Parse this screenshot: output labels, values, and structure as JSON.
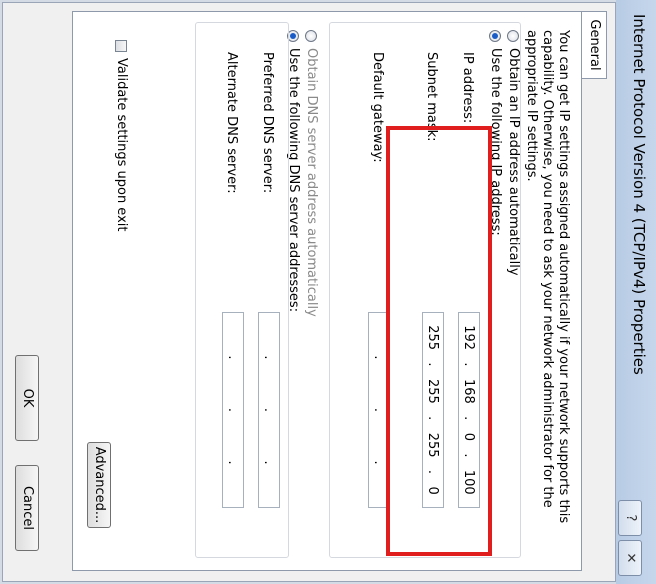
{
  "window": {
    "title": "Internet Protocol Version 4 (TCP/IPv4) Properties",
    "help_glyph": "?",
    "close_glyph": "✕"
  },
  "tabs": [
    {
      "label": "General"
    }
  ],
  "general": {
    "intro": "You can get IP settings assigned automatically if your network supports this capability. Otherwise, you need to ask your network administrator for the appropriate IP settings.",
    "ip_mode": {
      "auto_label": "Obtain an IP address automatically",
      "manual_label": "Use the following IP address:",
      "selected": "manual"
    },
    "ip_fields": {
      "ip_label": "IP address:",
      "ip_value": [
        "192",
        "168",
        "0",
        "100"
      ],
      "subnet_label": "Subnet mask:",
      "subnet_value": [
        "255",
        "255",
        "255",
        "0"
      ],
      "gateway_label": "Default gateway:",
      "gateway_value": [
        "",
        "",
        "",
        ""
      ]
    },
    "dns_mode": {
      "auto_label": "Obtain DNS server address automatically",
      "manual_label": "Use the following DNS server addresses:",
      "selected": "manual"
    },
    "dns_fields": {
      "preferred_label": "Preferred DNS server:",
      "preferred_value": [
        "",
        "",
        "",
        ""
      ],
      "alternate_label": "Alternate DNS server:",
      "alternate_value": [
        "",
        "",
        "",
        ""
      ]
    },
    "validate_label": "Validate settings upon exit",
    "validate_checked": false,
    "advanced_label": "Advanced..."
  },
  "footer": {
    "ok_label": "OK",
    "cancel_label": "Cancel"
  },
  "highlight_color": "#e01e1e"
}
